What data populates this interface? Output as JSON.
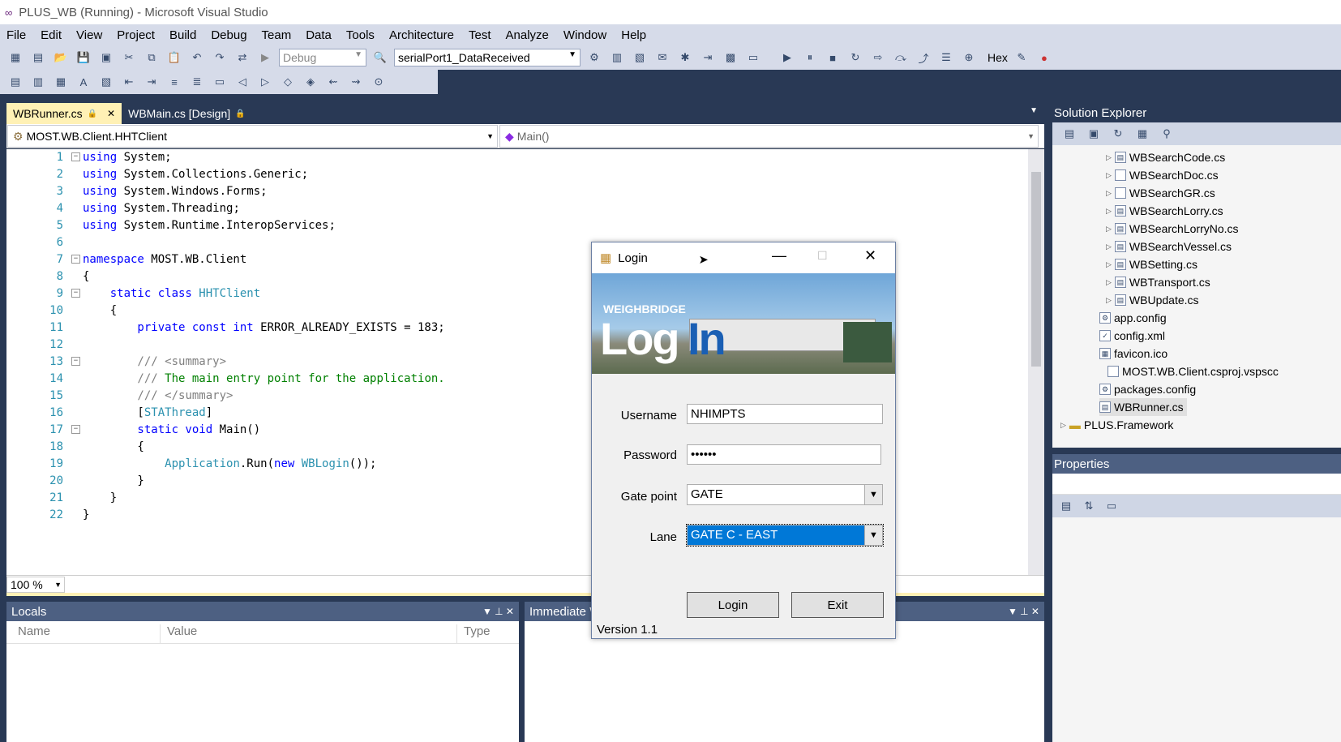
{
  "window": {
    "title": "PLUS_WB (Running) - Microsoft Visual Studio",
    "logo_glyph": "∞"
  },
  "menu": [
    "File",
    "Edit",
    "View",
    "Project",
    "Build",
    "Debug",
    "Team",
    "Data",
    "Tools",
    "Architecture",
    "Test",
    "Analyze",
    "Window",
    "Help"
  ],
  "toolbar": {
    "config": "Debug",
    "method": "serialPort1_DataReceived",
    "hex_label": "Hex"
  },
  "tabs": [
    {
      "label": "WBRunner.cs",
      "lock": "🔒",
      "close": "✕"
    },
    {
      "label": "WBMain.cs [Design]",
      "lock": "🔒"
    }
  ],
  "nav": {
    "type": "MOST.WB.Client.HHTClient",
    "member": "Main()"
  },
  "code": {
    "line_numbers": [
      "1",
      "2",
      "3",
      "4",
      "5",
      "6",
      "7",
      "8",
      "9",
      "10",
      "11",
      "12",
      "13",
      "14",
      "15",
      "16",
      "17",
      "18",
      "19",
      "20",
      "21",
      "22"
    ],
    "l1a": "using",
    "l1b": " System;",
    "l2a": "using",
    "l2b": " System.Collections.Generic;",
    "l3a": "using",
    "l3b": " System.Windows.Forms;",
    "l4a": "using",
    "l4b": " System.Threading;",
    "l5a": "using",
    "l5b": " System.Runtime.InteropServices;",
    "l7a": "namespace",
    "l7b": " MOST.WB.Client",
    "l8": "{",
    "l9a": "    static class ",
    "l9b": "HHTClient",
    "l10": "    {",
    "l11a": "        private const int",
    "l11b": " ERROR_ALREADY_EXISTS = 183;",
    "l13a": "        /// ",
    "l13b": "<summary>",
    "l14a": "        /// ",
    "l14b": "The main entry point for the application.",
    "l15a": "        /// ",
    "l15b": "</summary>",
    "l16a": "        [",
    "l16b": "STAThread",
    "l16c": "]",
    "l17a": "        static void",
    "l17b": " Main()",
    "l18": "        {",
    "l19a": "            ",
    "l19b": "Application",
    "l19c": ".Run(",
    "l19d": "new ",
    "l19e": "WBLogin",
    "l19f": "());",
    "l20": "        }",
    "l21": "    }",
    "l22": "}"
  },
  "zoom": "100 %",
  "locals": {
    "title": "Locals",
    "col_name": "Name",
    "col_value": "Value",
    "col_type": "Type"
  },
  "immediate": {
    "title": "Immediate W"
  },
  "solution_explorer": {
    "title": "Solution Explorer",
    "items": [
      "WBSearchCode.cs",
      "WBSearchDoc.cs",
      "WBSearchGR.cs",
      "WBSearchLorry.cs",
      "WBSearchLorryNo.cs",
      "WBSearchVessel.cs",
      "WBSetting.cs",
      "WBTransport.cs",
      "WBUpdate.cs",
      "app.config",
      "config.xml",
      "favicon.ico",
      "MOST.WB.Client.csproj.vspscc",
      "packages.config",
      "WBRunner.cs",
      "PLUS.Framework"
    ]
  },
  "properties": {
    "title": "Properties"
  },
  "login": {
    "title": "Login",
    "banner_small": "WEIGHBRIDGE",
    "banner_log": "Log",
    "banner_in": "In",
    "username_label": "Username",
    "username_value": "NHIMPTS",
    "password_label": "Password",
    "password_value": "••••••",
    "gate_label": "Gate point",
    "gate_value": "GATE",
    "lane_label": "Lane",
    "lane_value": "GATE C - EAST",
    "login_button": "Login",
    "exit_button": "Exit",
    "version": "Version 1.1"
  }
}
